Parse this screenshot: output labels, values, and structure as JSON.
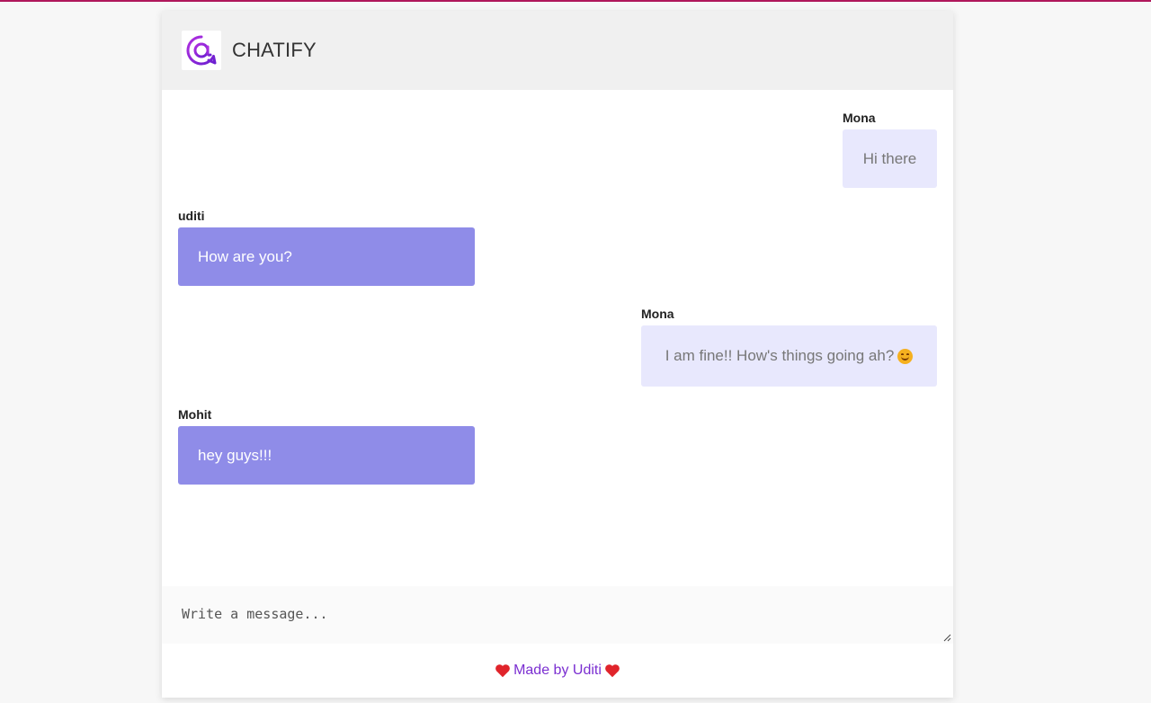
{
  "app": {
    "brand_name": "CHATIFY",
    "logo_icon": "chat-bubble-at-icon",
    "accent_color": "#b0175b",
    "brand_color": "#7b2fd1"
  },
  "messages": [
    {
      "sender": "Mona",
      "text": "Hi there",
      "direction": "outgoing"
    },
    {
      "sender": "uditi",
      "text": "How are you?",
      "direction": "incoming"
    },
    {
      "sender": "Mona",
      "text": "I am fine!! How's things going ah?",
      "emoji": "smiling-face-emoji",
      "direction": "outgoing"
    },
    {
      "sender": "Mohit",
      "text": "hey guys!!!",
      "direction": "incoming"
    }
  ],
  "colors": {
    "incoming_bubble": "#8f8ce8",
    "outgoing_bubble": "#e8e8fd"
  },
  "composer": {
    "placeholder": "Write a message..."
  },
  "footer": {
    "text": "Made by Uditi",
    "icon": "heart-icon"
  }
}
